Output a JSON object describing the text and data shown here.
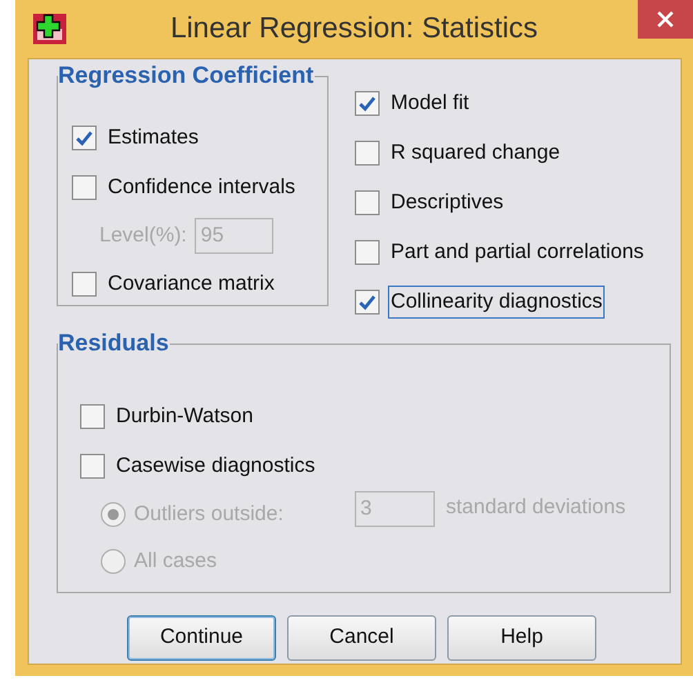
{
  "window": {
    "title": "Linear Regression: Statistics"
  },
  "regression_coefficient": {
    "title": "Regression Coefficient",
    "items": [
      {
        "kind": "checkbox",
        "label": "Estimates",
        "checked": true,
        "disabled": false,
        "focused": false
      },
      {
        "kind": "checkbox",
        "label": "Confidence intervals",
        "checked": false,
        "disabled": false,
        "focused": false
      },
      {
        "kind": "field",
        "label": "Level(%):",
        "value": "95",
        "disabled": true
      },
      {
        "kind": "checkbox",
        "label": "Covariance matrix",
        "checked": false,
        "disabled": false,
        "focused": false
      }
    ]
  },
  "right_options": [
    {
      "label": "Model fit",
      "checked": true,
      "focused": false
    },
    {
      "label": "R squared change",
      "checked": false,
      "focused": false
    },
    {
      "label": "Descriptives",
      "checked": false,
      "focused": false
    },
    {
      "label": "Part and partial correlations",
      "checked": false,
      "focused": false
    },
    {
      "label": "Collinearity diagnostics",
      "checked": true,
      "focused": true
    }
  ],
  "residuals": {
    "title": "Residuals",
    "items": [
      {
        "kind": "checkbox",
        "label": "Durbin-Watson",
        "checked": false,
        "disabled": false
      },
      {
        "kind": "checkbox",
        "label": "Casewise diagnostics",
        "checked": false,
        "disabled": false
      },
      {
        "kind": "radio",
        "label": "Outliers outside:",
        "selected": true,
        "disabled": true,
        "value": "3",
        "suffix": "standard deviations"
      },
      {
        "kind": "radio",
        "label": "All cases",
        "selected": false,
        "disabled": true
      }
    ]
  },
  "buttons": [
    {
      "label": "Continue",
      "default": true
    },
    {
      "label": "Cancel",
      "default": false
    },
    {
      "label": "Help",
      "default": false
    }
  ]
}
